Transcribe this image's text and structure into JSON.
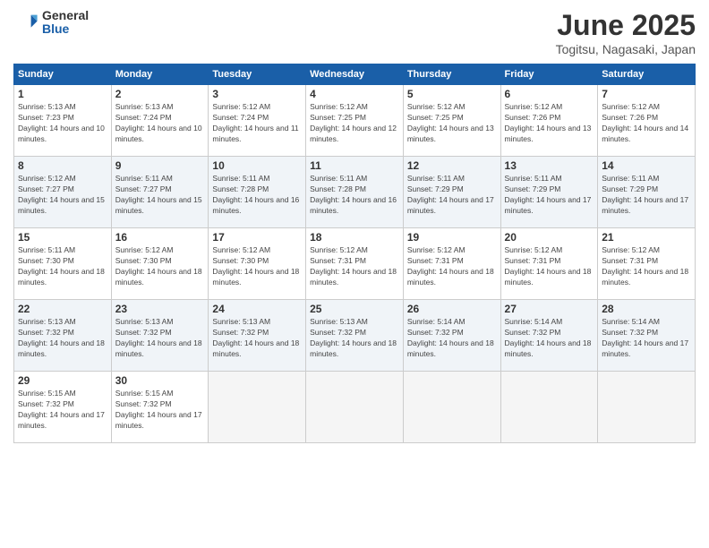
{
  "logo": {
    "general": "General",
    "blue": "Blue"
  },
  "title": {
    "month": "June 2025",
    "location": "Togitsu, Nagasaki, Japan"
  },
  "days_of_week": [
    "Sunday",
    "Monday",
    "Tuesday",
    "Wednesday",
    "Thursday",
    "Friday",
    "Saturday"
  ],
  "weeks": [
    [
      {
        "day": 1,
        "sunrise": "5:13 AM",
        "sunset": "7:23 PM",
        "daylight": "14 hours and 10 minutes."
      },
      {
        "day": 2,
        "sunrise": "5:13 AM",
        "sunset": "7:24 PM",
        "daylight": "14 hours and 10 minutes."
      },
      {
        "day": 3,
        "sunrise": "5:12 AM",
        "sunset": "7:24 PM",
        "daylight": "14 hours and 11 minutes."
      },
      {
        "day": 4,
        "sunrise": "5:12 AM",
        "sunset": "7:25 PM",
        "daylight": "14 hours and 12 minutes."
      },
      {
        "day": 5,
        "sunrise": "5:12 AM",
        "sunset": "7:25 PM",
        "daylight": "14 hours and 13 minutes."
      },
      {
        "day": 6,
        "sunrise": "5:12 AM",
        "sunset": "7:26 PM",
        "daylight": "14 hours and 13 minutes."
      },
      {
        "day": 7,
        "sunrise": "5:12 AM",
        "sunset": "7:26 PM",
        "daylight": "14 hours and 14 minutes."
      }
    ],
    [
      {
        "day": 8,
        "sunrise": "5:12 AM",
        "sunset": "7:27 PM",
        "daylight": "14 hours and 15 minutes."
      },
      {
        "day": 9,
        "sunrise": "5:11 AM",
        "sunset": "7:27 PM",
        "daylight": "14 hours and 15 minutes."
      },
      {
        "day": 10,
        "sunrise": "5:11 AM",
        "sunset": "7:28 PM",
        "daylight": "14 hours and 16 minutes."
      },
      {
        "day": 11,
        "sunrise": "5:11 AM",
        "sunset": "7:28 PM",
        "daylight": "14 hours and 16 minutes."
      },
      {
        "day": 12,
        "sunrise": "5:11 AM",
        "sunset": "7:29 PM",
        "daylight": "14 hours and 17 minutes."
      },
      {
        "day": 13,
        "sunrise": "5:11 AM",
        "sunset": "7:29 PM",
        "daylight": "14 hours and 17 minutes."
      },
      {
        "day": 14,
        "sunrise": "5:11 AM",
        "sunset": "7:29 PM",
        "daylight": "14 hours and 17 minutes."
      }
    ],
    [
      {
        "day": 15,
        "sunrise": "5:11 AM",
        "sunset": "7:30 PM",
        "daylight": "14 hours and 18 minutes."
      },
      {
        "day": 16,
        "sunrise": "5:12 AM",
        "sunset": "7:30 PM",
        "daylight": "14 hours and 18 minutes."
      },
      {
        "day": 17,
        "sunrise": "5:12 AM",
        "sunset": "7:30 PM",
        "daylight": "14 hours and 18 minutes."
      },
      {
        "day": 18,
        "sunrise": "5:12 AM",
        "sunset": "7:31 PM",
        "daylight": "14 hours and 18 minutes."
      },
      {
        "day": 19,
        "sunrise": "5:12 AM",
        "sunset": "7:31 PM",
        "daylight": "14 hours and 18 minutes."
      },
      {
        "day": 20,
        "sunrise": "5:12 AM",
        "sunset": "7:31 PM",
        "daylight": "14 hours and 18 minutes."
      },
      {
        "day": 21,
        "sunrise": "5:12 AM",
        "sunset": "7:31 PM",
        "daylight": "14 hours and 18 minutes."
      }
    ],
    [
      {
        "day": 22,
        "sunrise": "5:13 AM",
        "sunset": "7:32 PM",
        "daylight": "14 hours and 18 minutes."
      },
      {
        "day": 23,
        "sunrise": "5:13 AM",
        "sunset": "7:32 PM",
        "daylight": "14 hours and 18 minutes."
      },
      {
        "day": 24,
        "sunrise": "5:13 AM",
        "sunset": "7:32 PM",
        "daylight": "14 hours and 18 minutes."
      },
      {
        "day": 25,
        "sunrise": "5:13 AM",
        "sunset": "7:32 PM",
        "daylight": "14 hours and 18 minutes."
      },
      {
        "day": 26,
        "sunrise": "5:14 AM",
        "sunset": "7:32 PM",
        "daylight": "14 hours and 18 minutes."
      },
      {
        "day": 27,
        "sunrise": "5:14 AM",
        "sunset": "7:32 PM",
        "daylight": "14 hours and 18 minutes."
      },
      {
        "day": 28,
        "sunrise": "5:14 AM",
        "sunset": "7:32 PM",
        "daylight": "14 hours and 17 minutes."
      }
    ],
    [
      {
        "day": 29,
        "sunrise": "5:15 AM",
        "sunset": "7:32 PM",
        "daylight": "14 hours and 17 minutes."
      },
      {
        "day": 30,
        "sunrise": "5:15 AM",
        "sunset": "7:32 PM",
        "daylight": "14 hours and 17 minutes."
      },
      null,
      null,
      null,
      null,
      null
    ]
  ]
}
